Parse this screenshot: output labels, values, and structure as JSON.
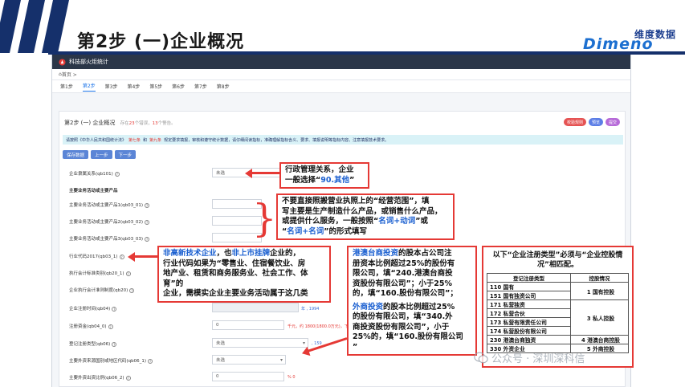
{
  "slide": {
    "title": "第2步  (一)企业概况",
    "logo_cn": "维度数据",
    "logo_en": "Dimeno",
    "watermark": "公众号 · 深圳深科信"
  },
  "app": {
    "name": "科技部火炬统计",
    "breadcrumb": "首页 > ",
    "steps": [
      "第1步",
      "第2步",
      "第3步",
      "第4步",
      "第5步",
      "第6步",
      "第7步",
      "第8步"
    ],
    "active_step": "第2步",
    "panel_title": "第2步 (一) 企业概况",
    "panel_sub_prefix": "存在",
    "panel_sub_count1": "23",
    "panel_sub_mid": "个错误，",
    "panel_sub_count2": "13",
    "panel_sub_suffix": "个警告。",
    "header_buttons": [
      "校验规则",
      "预览",
      "提交"
    ],
    "notice_prefix": "请按照《中华人民共和国统计法》",
    "notice_hl1": "第七条",
    "notice_mid": "和",
    "notice_hl2": "第九条",
    "notice_rest": "规定要求填报，审核和遵守统计数据，请仔细阅读指标，准确理解指标含义、要求、填报说明等指标内容。注意填报技术要求。",
    "action_buttons": [
      "保存数据",
      "上一步",
      "下一步"
    ],
    "fields": {
      "admin_rel_label": "企业隶属关系(qb101)",
      "admin_rel_value": "未选",
      "main_products_section": "主要业务活动或主要产品",
      "product1_label": "主要业务活动或主要产品1(qb03_01)",
      "product2_label": "主要业务活动或主要产品2(qb03_02)",
      "product3_label": "主要业务活动或主要产品3(qb03_03)",
      "industry_code_label": "行业代码2017(qb03_1)",
      "exec_accounting_label": "执行会计标准类别(qb20_1)",
      "exec_accounting_system_label": "企业执行会计准则制度(qb20)",
      "reg_time_label": "企业注册时间(qb04)",
      "reg_time_hint": "年 , 1994",
      "reg_capital_label": "注册资金(qb04_0)",
      "reg_capital_value": "0",
      "reg_capital_hint": "千元，约 1800(1800.0万元)，下限",
      "reg_type_label": "登记注册类型(qb06)",
      "reg_type_value": "未选",
      "reg_type_hint": ", 159",
      "foreign_country_label": "主要外资来源国别或地区代码(qb06_1)",
      "foreign_country_value": "未选",
      "foreign_ratio_label": "主要外资出资比例(qb06_2)",
      "foreign_ratio_value": "0",
      "foreign_ratio_hint": "% 0"
    }
  },
  "callouts": {
    "admin": [
      "行政管理关系，企业",
      "一般选择“",
      "90.其他",
      "”"
    ],
    "products": [
      "不要直接照搬营业执照上的“经营范围”，填",
      "写主要是生产制造什么产品，或销售什么产品，",
      "或提供什么服务，一般按照“",
      "名词+动词",
      "”或",
      "“",
      "名词+名词",
      "”的形式填写"
    ],
    "hightech": [
      "非高新技术企业",
      "，也",
      "非上市挂牌",
      "企业的，",
      "行业代码如果为“零售业、住宿餐饮业、房",
      "地产业、租赁和商务服务业、社会工作、体育”的",
      "企业，需模实企业主要业务活动属于这几类"
    ],
    "hk": [
      "港澳台商投资",
      "的股本占公司注",
      "册资本比例超过25%的股份有",
      "限公司，填“240.港澳台商投",
      "资股份有限公司”；小于25%",
      "的，填“160.股份有限公司”；",
      "外商投资",
      "的股本比例超过25%",
      "的股份有限公司，填“340.外",
      "商投资股份有限公司”，小于",
      "25%的，填“160.股份有限公司",
      "”"
    ]
  },
  "type_table": {
    "title": "以下“企业注册类型”必须与“企业控股情况”相匹配。",
    "headers": [
      "登记注册类型",
      "控股情况"
    ],
    "rows": [
      {
        "type": "110 国有",
        "control": "1 国有控股"
      },
      {
        "type": "151 国有独资公司",
        "control": ""
      },
      {
        "type": "171 私营独资",
        "control": "3 私人控股"
      },
      {
        "type": "172 私营合伙",
        "control": ""
      },
      {
        "type": "173 私营有限责任公司",
        "control": ""
      },
      {
        "type": "174 私营股份有限公司",
        "control": ""
      },
      {
        "type": "230 港澳台商独资",
        "control": "4 港澳台商控股"
      },
      {
        "type": "330 外资企业",
        "control": "5 外商控股"
      }
    ]
  },
  "colors": {
    "accent_red": "#e53935",
    "accent_blue": "#1a5fd0",
    "title_rule": "#15306b"
  }
}
